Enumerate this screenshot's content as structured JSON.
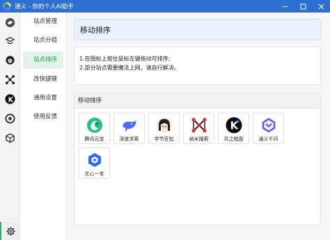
{
  "window": {
    "title": "通义 - 你的个人AI助手",
    "controls": [
      "minimize-icon",
      "maximize-icon",
      "close-icon"
    ]
  },
  "rail": {
    "icons": [
      "tongyi-icon",
      "translate-icon",
      "doubao-icon",
      "nami-icon",
      "kimi-icon",
      "openai-icon",
      "cube-icon"
    ],
    "bottom_icon": "settings-gear-icon",
    "active_color": "#2eaa68"
  },
  "nav": {
    "items": [
      {
        "label": "站点管理",
        "active": false
      },
      {
        "label": "站点分组",
        "active": false
      },
      {
        "label": "站点排序",
        "active": true
      },
      {
        "label": "改快捷键",
        "active": false
      },
      {
        "label": "通用设置",
        "active": false
      },
      {
        "label": "使用反馈",
        "active": false
      }
    ]
  },
  "main": {
    "header": "移动排序",
    "tips": [
      "1.在图标上按住鼠标左键拖动可排序;",
      "2.部分站点需要魔法上网，请自行解决。"
    ],
    "sort_title": "移动排序",
    "tiles": [
      {
        "label": "腾讯元宝",
        "icon": "yuanbao-icon"
      },
      {
        "label": "深度求索",
        "icon": "deepseek-whale-icon"
      },
      {
        "label": "字节豆包",
        "icon": "doubao-avatar-icon"
      },
      {
        "label": "纳米搜索",
        "icon": "nami-icon"
      },
      {
        "label": "月之暗面",
        "icon": "kimi-icon"
      },
      {
        "label": "通义千问",
        "icon": "tongyi-icon"
      },
      {
        "label": "文心一言",
        "icon": "wenxin-icon"
      }
    ]
  },
  "colors": {
    "titlebar": "#2f6fd2",
    "nav_active_bg": "#e2f4ea",
    "nav_active_text": "#1f9a58",
    "header_bg": "#eaf2fd"
  }
}
